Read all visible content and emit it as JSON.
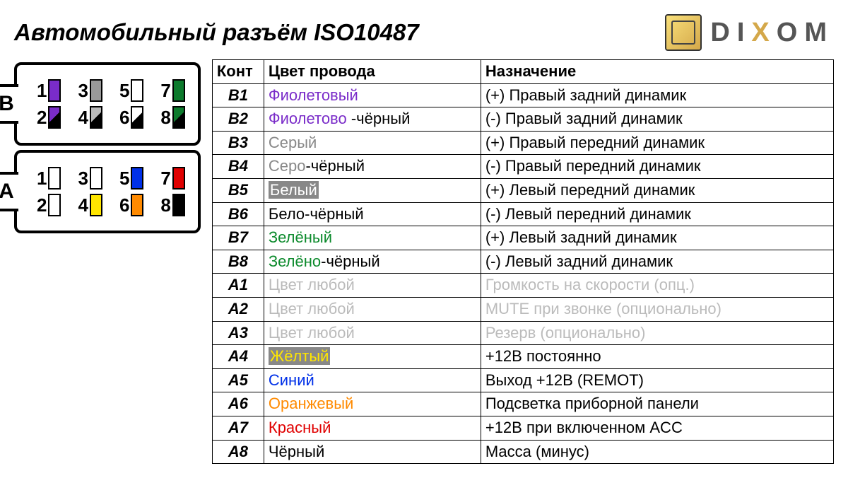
{
  "title": "Автомобильный разъём ISO10487",
  "logo": {
    "d": "D",
    "i": "I",
    "x": "X",
    "o": "O",
    "m": "M"
  },
  "headers": {
    "pin": "Конт",
    "color": "Цвет провода",
    "func": "Назначение"
  },
  "blockB": {
    "label": "B",
    "pins_top": [
      {
        "n": "1",
        "c": "#7a2cc9"
      },
      {
        "n": "3",
        "c": "#999"
      },
      {
        "n": "5",
        "c": "#fff"
      },
      {
        "n": "7",
        "c": "#0c7a2c"
      }
    ],
    "pins_bottom": [
      {
        "n": "2",
        "c": "#7a2cc9",
        "half": true
      },
      {
        "n": "4",
        "c": "#bbb",
        "half": true
      },
      {
        "n": "6",
        "c": "#fff",
        "half": true
      },
      {
        "n": "8",
        "c": "#0c7a2c",
        "half": true
      }
    ]
  },
  "blockA": {
    "label": "A",
    "pins_top": [
      {
        "n": "1",
        "c": "#fff"
      },
      {
        "n": "3",
        "c": "#fff"
      },
      {
        "n": "5",
        "c": "#0030e8"
      },
      {
        "n": "7",
        "c": "#e00000"
      }
    ],
    "pins_bottom": [
      {
        "n": "2",
        "c": "#fff"
      },
      {
        "n": "4",
        "c": "#ffe600"
      },
      {
        "n": "6",
        "c": "#ff8a00"
      },
      {
        "n": "8",
        "c": "#000"
      }
    ]
  },
  "rows": [
    {
      "pin": "B1",
      "color_html": "<span style='color:#7a2cc9'>Фиолетовый</span>",
      "func": "(+) Правый задний динамик"
    },
    {
      "pin": "B2",
      "color_html": "<span style='color:#7a2cc9'>Фиолетово</span> -чёрный",
      "func": "(-)  Правый задний динамик"
    },
    {
      "pin": "B3",
      "color_html": "<span style='color:#888'>Серый</span>",
      "func": "(+) Правый передний динамик"
    },
    {
      "pin": "B4",
      "color_html": "<span style='color:#888'>Серо</span>-чёрный",
      "func": "(-)  Правый передний динамик"
    },
    {
      "pin": "B5",
      "color_html": "<span class='hl-grey'>Белый</span>",
      "func": "(+) Левый передний динамик"
    },
    {
      "pin": "B6",
      "color_html": "Бело-чёрный",
      "func": "(-)  Левый передний динамик"
    },
    {
      "pin": "B7",
      "color_html": "<span style='color:#0c8a2c'>Зелёный</span>",
      "func": "(+) Левый задний динамик"
    },
    {
      "pin": "B8",
      "color_html": "<span style='color:#0c8a2c'>Зелёно</span>-чёрный",
      "func": "(-)  Левый задний динамик"
    },
    {
      "pin": "A1",
      "color_html": "<span class='faded'>Цвет любой</span>",
      "func_html": "<span class='faded'>Громкость на скорости (опц.)</span>"
    },
    {
      "pin": "A2",
      "color_html": "<span class='faded'>Цвет любой</span>",
      "func_html": "<span class='faded'>MUTE при звонке (опционально)</span>"
    },
    {
      "pin": "A3",
      "color_html": "<span class='faded'>Цвет любой</span>",
      "func_html": "<span class='faded'>Резерв (опционально)</span>"
    },
    {
      "pin": "A4",
      "color_html": "<span class='hl-grey' style='color:#ffe600'>Жёлтый</span>",
      "func": "+12В постоянно"
    },
    {
      "pin": "A5",
      "color_html": "<span style='color:#0030e8'>Синий</span>",
      "func": "Выход +12В (REMOT)"
    },
    {
      "pin": "A6",
      "color_html": "<span style='color:#ff8a00'>Оранжевый</span>",
      "func": "Подсветка приборной панели"
    },
    {
      "pin": "A7",
      "color_html": "<span style='color:#e00000'>Красный</span>",
      "func": "+12В при включенном ACC"
    },
    {
      "pin": "A8",
      "color_html": "Чёрный",
      "func": "Масса (минус)"
    }
  ]
}
